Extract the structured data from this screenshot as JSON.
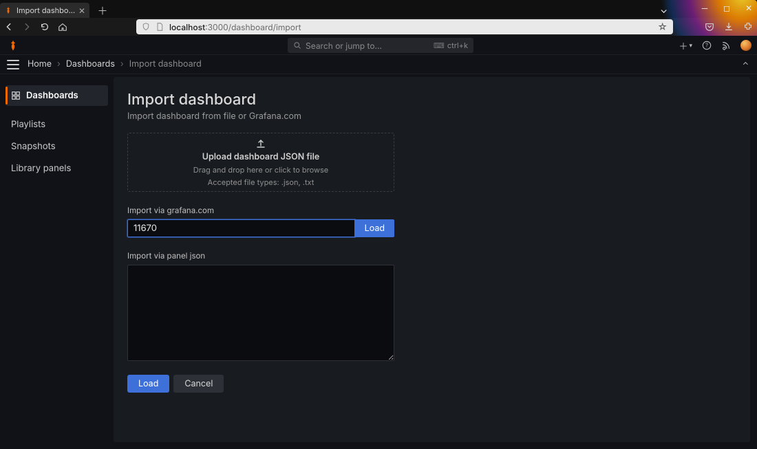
{
  "browser": {
    "tab_title": "Import dashboard - Dashboar",
    "url_host": "localhost",
    "url_port_path": ":3000/dashboard/import"
  },
  "header": {
    "search_placeholder": "Search or jump to...",
    "search_shortcut": "ctrl+k"
  },
  "breadcrumb": {
    "home": "Home",
    "section": "Dashboards",
    "current": "Import dashboard"
  },
  "sidebar": {
    "items": [
      {
        "label": "Dashboards"
      },
      {
        "label": "Playlists"
      },
      {
        "label": "Snapshots"
      },
      {
        "label": "Library panels"
      }
    ]
  },
  "page": {
    "title": "Import dashboard",
    "subtitle": "Import dashboard from file or Grafana.com",
    "dropzone": {
      "title": "Upload dashboard JSON file",
      "hint1": "Drag and drop here or click to browse",
      "hint2": "Accepted file types: .json, .txt"
    },
    "grafanacom": {
      "label": "Import via grafana.com",
      "value": "11670",
      "button": "Load"
    },
    "paneljson": {
      "label": "Import via panel json",
      "value": ""
    },
    "actions": {
      "load": "Load",
      "cancel": "Cancel"
    }
  }
}
